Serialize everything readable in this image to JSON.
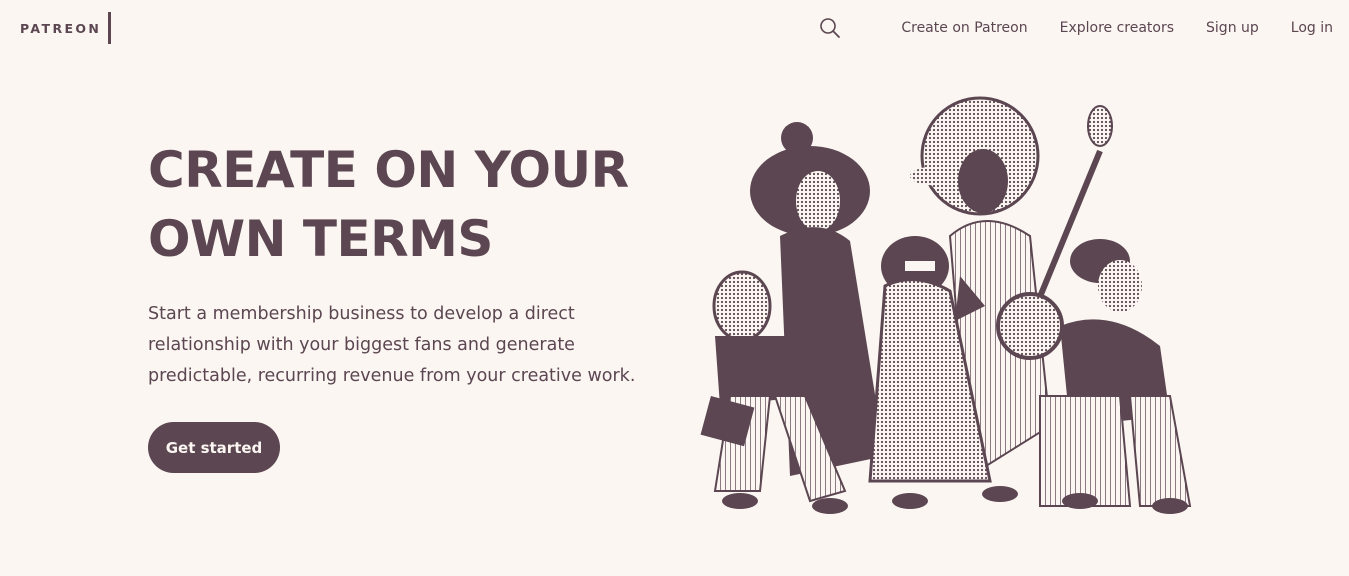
{
  "brand": {
    "name": "PATREON"
  },
  "nav": {
    "search_icon": "search-icon",
    "items": [
      {
        "label": "Create on Patreon"
      },
      {
        "label": "Explore creators"
      },
      {
        "label": "Sign up"
      },
      {
        "label": "Log in"
      }
    ]
  },
  "hero": {
    "title_line1": "CREATE ON YOUR",
    "title_line2": "OWN TERMS",
    "subtitle": "Start a membership business to develop a direct relationship with your biggest fans and generate predictable, recurring revenue from your creative work.",
    "cta_label": "Get started",
    "illustration": "group-of-creators-illustration"
  },
  "colors": {
    "background": "#fbf6f2",
    "brand": "#5b4651",
    "button_text": "#fbf6f2"
  }
}
